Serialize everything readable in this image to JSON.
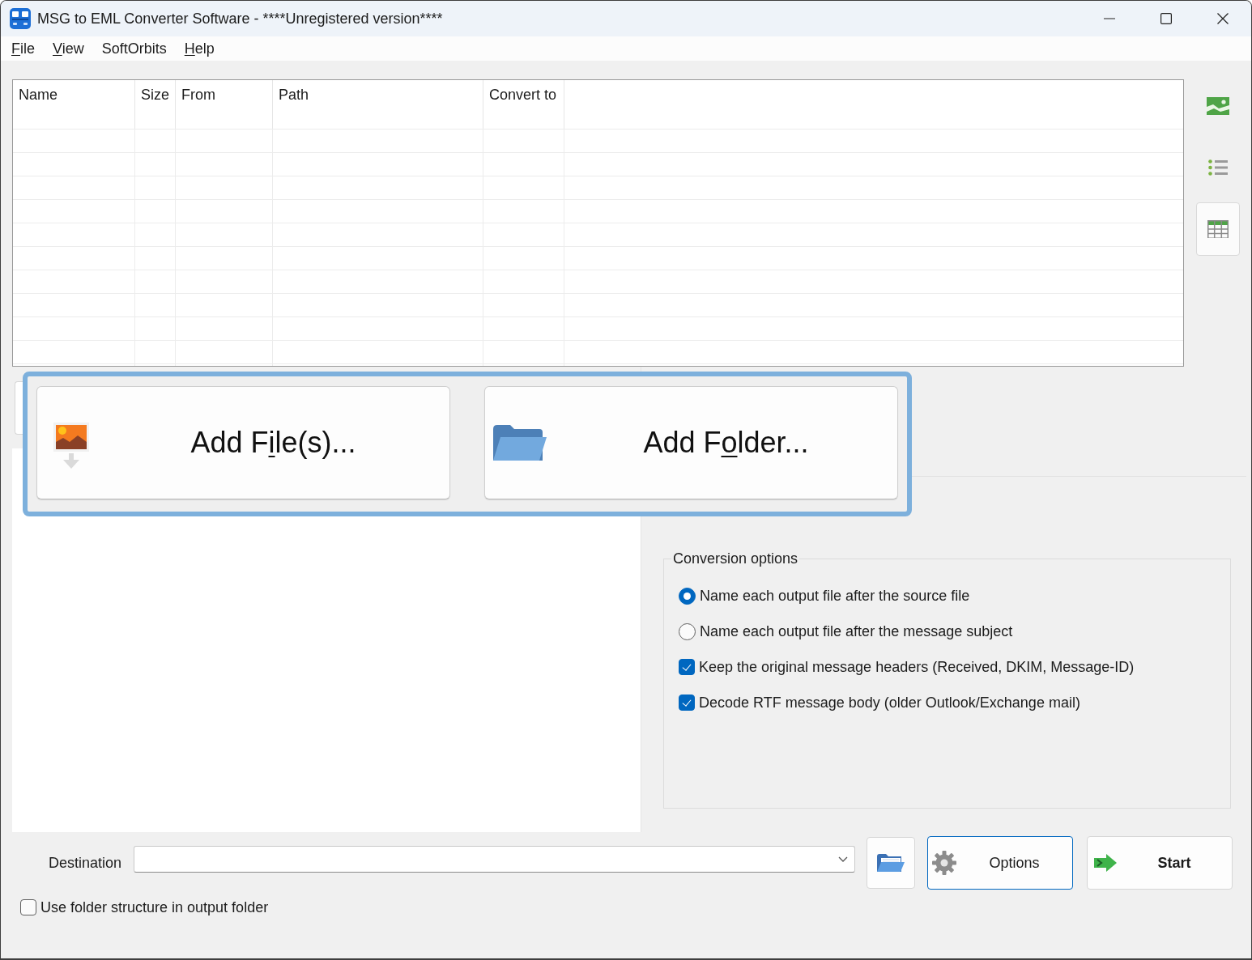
{
  "window": {
    "title": "MSG to EML Converter Software - ****Unregistered version****"
  },
  "menu": [
    {
      "access_key": "F",
      "text_after": "ile"
    },
    {
      "access_key": "V",
      "text_after": "iew"
    },
    {
      "text_before": "SoftOrbits"
    },
    {
      "access_key": "H",
      "text_after": "elp"
    }
  ],
  "file_table": {
    "columns": [
      "Name",
      "Size",
      "From",
      "Path",
      "Convert to"
    ]
  },
  "view_buttons": [
    {
      "kind": "thumbnails",
      "selected": false
    },
    {
      "kind": "list",
      "selected": false
    },
    {
      "kind": "details",
      "selected": true
    }
  ],
  "add_buttons": [
    {
      "kind": "files",
      "text_before": "Add F",
      "access_key": "i",
      "text_after": "le(s)..."
    },
    {
      "kind": "folder",
      "text_before": "Add F",
      "access_key": "o",
      "text_after": "lder..."
    }
  ],
  "conversion_options": {
    "title": "Conversion options",
    "options": [
      {
        "kind": "radio",
        "label": "Name each output file after the source file",
        "selected": true
      },
      {
        "kind": "radio",
        "label": "Name each output file after the message subject",
        "selected": false
      },
      {
        "kind": "checkbox",
        "label": "Keep the original message headers (Received, DKIM, Message-ID)",
        "checked": true
      },
      {
        "kind": "checkbox",
        "label": "Decode RTF message body (older Outlook/Exchange mail)",
        "checked": true
      }
    ]
  },
  "destination": {
    "label": "Destination"
  },
  "action_buttons": [
    {
      "kind": "options",
      "label": "Options",
      "focused": true,
      "primary": false
    },
    {
      "kind": "start",
      "label": "Start",
      "focused": false,
      "primary": true
    }
  ],
  "folder_structure": {
    "label": "Use folder structure in output folder",
    "checked": false
  }
}
